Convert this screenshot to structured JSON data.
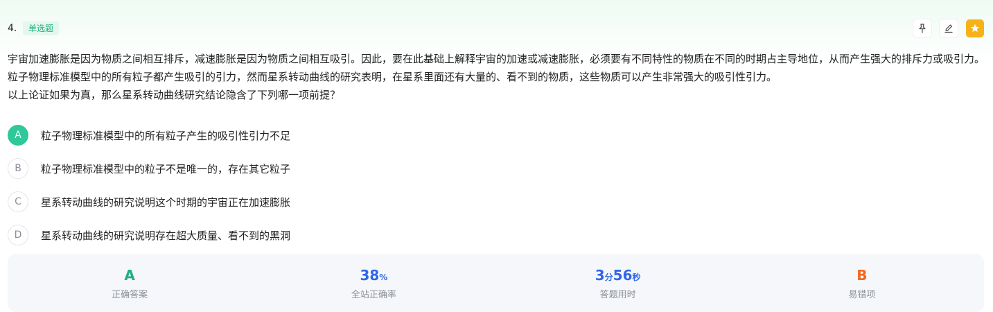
{
  "question": {
    "number": "4.",
    "type": "单选题",
    "stem_line1": "宇宙加速膨胀是因为物质之间相互排斥，减速膨胀是因为物质之间相互吸引。因此，要在此基础上解释宇宙的加速或减速膨胀，必须要有不同特性的物质在不同的时期占主导地位，从而产生强大的排斥力或吸引力。粒子物理标准模型中的所有粒子都产生吸引的引力，然而星系转动曲线的研究表明，在星系里面还有大量的、看不到的物质，这些物质可以产生非常强大的吸引性引力。",
    "stem_line2": "以上论证如果为真，那么星系转动曲线研究结论隐含了下列哪一项前提？"
  },
  "options": [
    {
      "letter": "A",
      "text": "粒子物理标准模型中的所有粒子产生的吸引性引力不足",
      "selected": true
    },
    {
      "letter": "B",
      "text": "粒子物理标准模型中的粒子不是唯一的，存在其它粒子",
      "selected": false
    },
    {
      "letter": "C",
      "text": "星系转动曲线的研究说明这个时期的宇宙正在加速膨胀",
      "selected": false
    },
    {
      "letter": "D",
      "text": "星系转动曲线的研究说明存在超大质量、看不到的黑洞",
      "selected": false
    }
  ],
  "toolbar": {
    "icons": [
      "pin-icon",
      "edit-icon",
      "star-icon"
    ]
  },
  "stats": {
    "correct_answer": "A",
    "correct_answer_label": "正确答案",
    "accuracy_value": "38",
    "accuracy_unit": "%",
    "accuracy_label": "全站正确率",
    "time_min": "3",
    "time_min_unit": "分",
    "time_sec": "56",
    "time_sec_unit": "秒",
    "time_label": "答题用时",
    "common_wrong": "B",
    "common_wrong_label": "易错项"
  },
  "colors": {
    "accent_green": "#1db17e",
    "option_selected": "#2ec89a",
    "blue": "#2f67e8",
    "orange": "#f4681e",
    "star_button": "#f7b21a"
  }
}
